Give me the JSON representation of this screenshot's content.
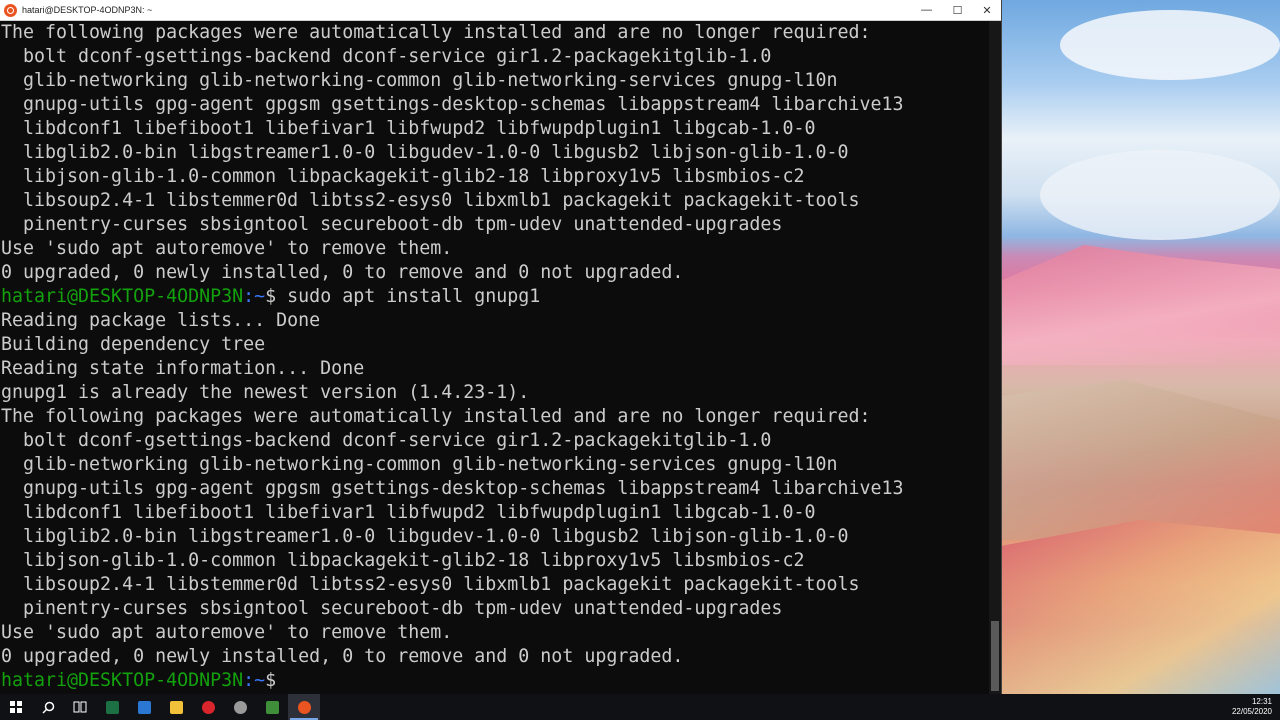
{
  "window": {
    "title": "hatari@DESKTOP-4ODNP3N: ~",
    "minimize_label": "—",
    "maximize_label": "☐",
    "close_label": "✕"
  },
  "terminal": {
    "lines": [
      {
        "type": "out",
        "text": "The following packages were automatically installed and are no longer required:"
      },
      {
        "type": "out",
        "text": "  bolt dconf-gsettings-backend dconf-service gir1.2-packagekitglib-1.0"
      },
      {
        "type": "out",
        "text": "  glib-networking glib-networking-common glib-networking-services gnupg-l10n"
      },
      {
        "type": "out",
        "text": "  gnupg-utils gpg-agent gpgsm gsettings-desktop-schemas libappstream4 libarchive13"
      },
      {
        "type": "out",
        "text": "  libdconf1 libefiboot1 libefivar1 libfwupd2 libfwupdplugin1 libgcab-1.0-0"
      },
      {
        "type": "out",
        "text": "  libglib2.0-bin libgstreamer1.0-0 libgudev-1.0-0 libgusb2 libjson-glib-1.0-0"
      },
      {
        "type": "out",
        "text": "  libjson-glib-1.0-common libpackagekit-glib2-18 libproxy1v5 libsmbios-c2"
      },
      {
        "type": "out",
        "text": "  libsoup2.4-1 libstemmer0d libtss2-esys0 libxmlb1 packagekit packagekit-tools"
      },
      {
        "type": "out",
        "text": "  pinentry-curses sbsigntool secureboot-db tpm-udev unattended-upgrades"
      },
      {
        "type": "out",
        "text": "Use 'sudo apt autoremove' to remove them."
      },
      {
        "type": "out",
        "text": "0 upgraded, 0 newly installed, 0 to remove and 0 not upgraded."
      },
      {
        "type": "prompt",
        "user": "hatari@DESKTOP-4ODNP3N",
        "path": ":~",
        "sym": "$ ",
        "cmd": "sudo apt install gnupg1"
      },
      {
        "type": "out",
        "text": "Reading package lists... Done"
      },
      {
        "type": "out",
        "text": "Building dependency tree"
      },
      {
        "type": "out",
        "text": "Reading state information... Done"
      },
      {
        "type": "out",
        "text": "gnupg1 is already the newest version (1.4.23-1)."
      },
      {
        "type": "out",
        "text": "The following packages were automatically installed and are no longer required:"
      },
      {
        "type": "out",
        "text": "  bolt dconf-gsettings-backend dconf-service gir1.2-packagekitglib-1.0"
      },
      {
        "type": "out",
        "text": "  glib-networking glib-networking-common glib-networking-services gnupg-l10n"
      },
      {
        "type": "out",
        "text": "  gnupg-utils gpg-agent gpgsm gsettings-desktop-schemas libappstream4 libarchive13"
      },
      {
        "type": "out",
        "text": "  libdconf1 libefiboot1 libefivar1 libfwupd2 libfwupdplugin1 libgcab-1.0-0"
      },
      {
        "type": "out",
        "text": "  libglib2.0-bin libgstreamer1.0-0 libgudev-1.0-0 libgusb2 libjson-glib-1.0-0"
      },
      {
        "type": "out",
        "text": "  libjson-glib-1.0-common libpackagekit-glib2-18 libproxy1v5 libsmbios-c2"
      },
      {
        "type": "out",
        "text": "  libsoup2.4-1 libstemmer0d libtss2-esys0 libxmlb1 packagekit packagekit-tools"
      },
      {
        "type": "out",
        "text": "  pinentry-curses sbsigntool secureboot-db tpm-udev unattended-upgrades"
      },
      {
        "type": "out",
        "text": "Use 'sudo apt autoremove' to remove them."
      },
      {
        "type": "out",
        "text": "0 upgraded, 0 newly installed, 0 to remove and 0 not upgraded."
      },
      {
        "type": "prompt",
        "user": "hatari@DESKTOP-4ODNP3N",
        "path": ":~",
        "sym": "$ ",
        "cmd": ""
      }
    ]
  },
  "taskbar": {
    "items": [
      {
        "name": "start-button-icon",
        "kind": "start"
      },
      {
        "name": "search-icon",
        "kind": "search"
      },
      {
        "name": "task-view-icon",
        "kind": "taskview"
      },
      {
        "name": "excel-icon",
        "kind": "app",
        "color": "#1d7044"
      },
      {
        "name": "file-icon",
        "kind": "app",
        "color": "#2b78d4"
      },
      {
        "name": "file-explorer-icon",
        "kind": "app",
        "color": "#f2c13a"
      },
      {
        "name": "opera-icon",
        "kind": "app",
        "color": "#d9262c"
      },
      {
        "name": "settings-icon",
        "kind": "app",
        "color": "#9a9a9a"
      },
      {
        "name": "notepad-icon",
        "kind": "app",
        "color": "#3f8f3a"
      },
      {
        "name": "ubuntu-icon",
        "kind": "app",
        "color": "#e95420",
        "active": true
      }
    ],
    "clock_time": "12:31",
    "clock_date": "22/05/2020"
  },
  "colors": {
    "terminal_bg": "#0c0c0c",
    "terminal_fg": "#cccccc",
    "prompt_user": "#13a10e",
    "prompt_path": "#3b78ff",
    "ubuntu_orange": "#e95420"
  }
}
